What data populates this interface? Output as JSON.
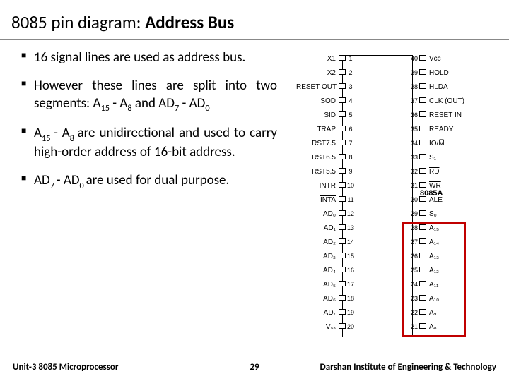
{
  "title_thin": "8085 pin diagram: ",
  "title_bold": "Address Bus",
  "bullets": {
    "b1": "16 signal lines are used as address bus.",
    "b2_a": "However these lines are split into two segments:  A",
    "b2_s1": "15",
    "b2_b": " - A",
    "b2_s2": "8",
    "b2_c": " and AD",
    "b2_s3": "7",
    "b2_d": " - AD",
    "b2_s4": "0",
    "b3_a": "A",
    "b3_s1": "15 ",
    "b3_b": "- A",
    "b3_s2": "8 ",
    "b3_c": "are unidirectional and used to carry high-order address of 16-bit address.",
    "b4_a": "AD",
    "b4_s1": "7 ",
    "b4_b": "- AD",
    "b4_s2": "0 ",
    "b4_c": "are used for dual purpose."
  },
  "chipname": "8085A",
  "left_pins": [
    {
      "label": "X1",
      "num": "1"
    },
    {
      "label": "X2",
      "num": "2"
    },
    {
      "label": "RESET OUT",
      "num": "3"
    },
    {
      "label": "SOD",
      "num": "4"
    },
    {
      "label": "SID",
      "num": "5"
    },
    {
      "label": "TRAP",
      "num": "6"
    },
    {
      "label": "RST7.5",
      "num": "7"
    },
    {
      "label": "RST6.5",
      "num": "8"
    },
    {
      "label": "RST5.5",
      "num": "9"
    },
    {
      "label": "INTR",
      "num": "10"
    },
    {
      "label": "INTA",
      "num": "11",
      "overbar": true
    },
    {
      "label": "AD₀",
      "num": "12"
    },
    {
      "label": "AD₁",
      "num": "13"
    },
    {
      "label": "AD₂",
      "num": "14"
    },
    {
      "label": "AD₃",
      "num": "15"
    },
    {
      "label": "AD₄",
      "num": "16"
    },
    {
      "label": "AD₅",
      "num": "17"
    },
    {
      "label": "AD₆",
      "num": "18"
    },
    {
      "label": "AD₇",
      "num": "19"
    },
    {
      "label": "Vₛₛ",
      "num": "20"
    }
  ],
  "right_pins": [
    {
      "label": "Vᴄᴄ",
      "num": "40"
    },
    {
      "label": "HOLD",
      "num": "39"
    },
    {
      "label": "HLDA",
      "num": "38"
    },
    {
      "label": "CLK (OUT)",
      "num": "37"
    },
    {
      "label": "RESET IN",
      "num": "36",
      "overbar": true
    },
    {
      "label": "READY",
      "num": "35"
    },
    {
      "label": "IO/M̅",
      "num": "34"
    },
    {
      "label": "S₁",
      "num": "33"
    },
    {
      "label": "RD",
      "num": "32",
      "overbar": true
    },
    {
      "label": "WR",
      "num": "31",
      "overbar": true
    },
    {
      "label": "ALE",
      "num": "30"
    },
    {
      "label": "S₀",
      "num": "29"
    },
    {
      "label": "A₁₅",
      "num": "28"
    },
    {
      "label": "A₁₄",
      "num": "27"
    },
    {
      "label": "A₁₃",
      "num": "26"
    },
    {
      "label": "A₁₂",
      "num": "25"
    },
    {
      "label": "A₁₁",
      "num": "24"
    },
    {
      "label": "A₁₀",
      "num": "23"
    },
    {
      "label": "A₉",
      "num": "22"
    },
    {
      "label": "A₈",
      "num": "21"
    }
  ],
  "footer": {
    "left": "Unit-3 8085 Microprocessor",
    "center": "29",
    "right": "Darshan Institute of Engineering & Technology"
  }
}
